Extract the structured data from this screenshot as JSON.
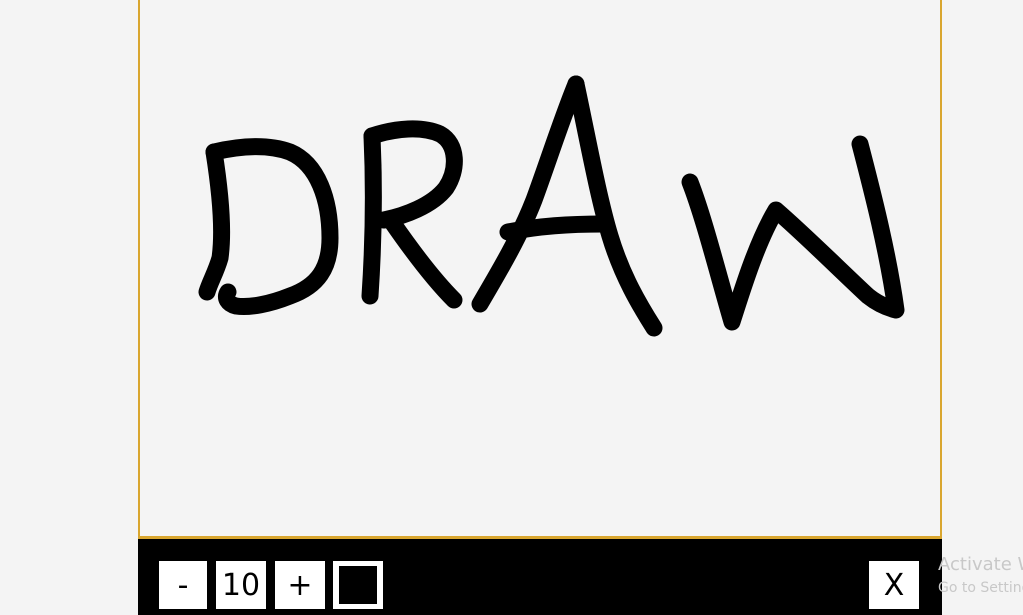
{
  "drawing": {
    "label": "DRAW",
    "stroke_color": "#000000"
  },
  "toolbar": {
    "decrease_label": "-",
    "brush_size": "10",
    "increase_label": "+",
    "current_color": "#000000",
    "close_label": "X"
  },
  "watermark": {
    "title": "Activate Windows",
    "subtitle": "Go to Settings to activate Windows."
  },
  "colors": {
    "frame_border": "#d9a62f",
    "canvas_background": "#f4f4f4",
    "toolbar_background": "#000000"
  }
}
